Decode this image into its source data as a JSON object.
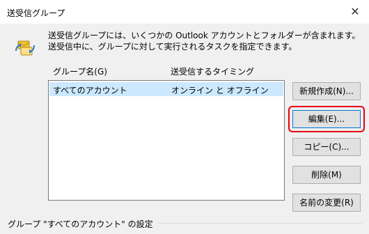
{
  "window": {
    "title": "送受信グループ",
    "close_glyph": "✕"
  },
  "description": "送受信グループには、いくつかの Outlook アカウントとフォルダーが含まれます。送受信中に、グループに対して実行されるタスクを指定できます。",
  "list": {
    "headers": {
      "name": "グループ名(G)",
      "timing": "送受信するタイミング"
    },
    "rows": [
      {
        "name": "すべてのアカウント",
        "timing": "オンライン と オフライン",
        "selected": true
      }
    ]
  },
  "buttons": {
    "new": "新規作成(N)...",
    "edit": "編集(E)...",
    "copy": "コピー(C)...",
    "delete": "削除(M)",
    "rename": "名前の変更(R)"
  },
  "group_settings_title": "グループ \"すべてのアカウント\" の設定",
  "colors": {
    "highlight": "#e60012",
    "selection": "#cce8ff"
  }
}
